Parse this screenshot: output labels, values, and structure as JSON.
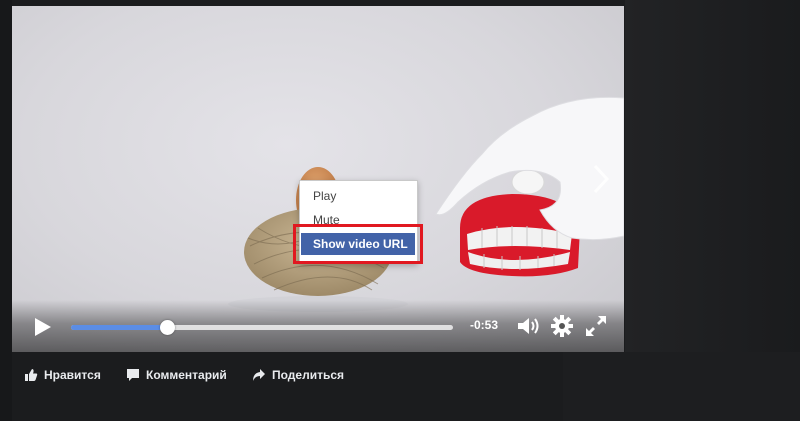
{
  "video": {
    "time_remaining": "-0:53",
    "progress_fraction": 0.25,
    "controls": {
      "play_icon": "play-icon",
      "volume_icon": "volume-icon",
      "settings_icon": "gear-icon",
      "fullscreen_icon": "fullscreen-icon",
      "next_icon": "chevron-right-icon"
    },
    "accent_color": "#5b8de5"
  },
  "context_menu": {
    "items": [
      {
        "label": "Play"
      },
      {
        "label": "Mute"
      },
      {
        "label": "Show video URL",
        "active": true
      }
    ],
    "active_color": "#4263a8",
    "highlight_color": "#e11820"
  },
  "actions": {
    "like_label": "Нравится",
    "comment_label": "Комментарий",
    "share_label": "Поделиться"
  }
}
